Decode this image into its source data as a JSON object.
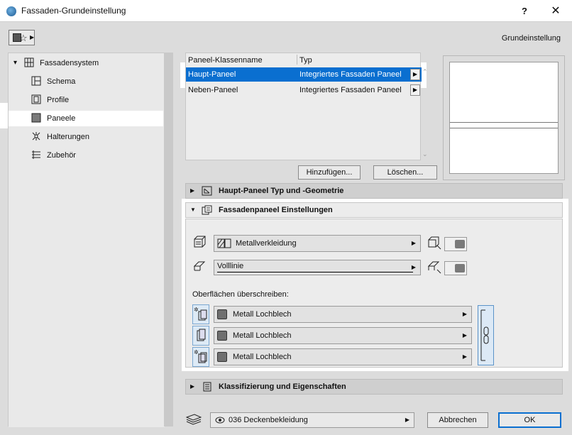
{
  "window": {
    "title": "Fassaden-Grundeinstellung",
    "help_label": "?",
    "close_label": "✕"
  },
  "toolbar": {
    "preset_label": "Grundeinstellung"
  },
  "tree": {
    "root": "Fassadensystem",
    "items": [
      {
        "label": "Schema",
        "icon": "schema-icon"
      },
      {
        "label": "Profile",
        "icon": "profile-icon"
      },
      {
        "label": "Paneele",
        "icon": "panel-icon",
        "selected": true
      },
      {
        "label": "Halterungen",
        "icon": "bracket-icon"
      },
      {
        "label": "Zubehör",
        "icon": "accessory-icon"
      }
    ]
  },
  "panel_table": {
    "headers": [
      "Paneel-Klassenname",
      "Typ"
    ],
    "rows": [
      {
        "name": "Haupt-Paneel",
        "type": "Integriertes Fassaden Paneel",
        "selected": true
      },
      {
        "name": "Neben-Paneel",
        "type": "Integriertes Fassaden Paneel",
        "selected": false
      }
    ]
  },
  "buttons": {
    "add": "Hinzufügen...",
    "delete": "Löschen..."
  },
  "sections": {
    "geometry": "Haupt-Paneel Typ und -Geometrie",
    "settings": "Fassadenpaneel Einstellungen",
    "classification": "Klassifizierung und Eigenschaften"
  },
  "settings": {
    "material": "Metallverkleidung",
    "line_type": "Volllinie",
    "override_label": "Oberflächen überschreiben:",
    "surfaces": [
      "Metall Lochblech",
      "Metall Lochblech",
      "Metall Lochblech"
    ]
  },
  "footer": {
    "layer": "036 Deckenbekleidung",
    "cancel": "Abbrechen",
    "ok": "OK"
  },
  "colors": {
    "selection_blue": "#0a6fd0",
    "surface_swatch": "#6f6f6f"
  }
}
